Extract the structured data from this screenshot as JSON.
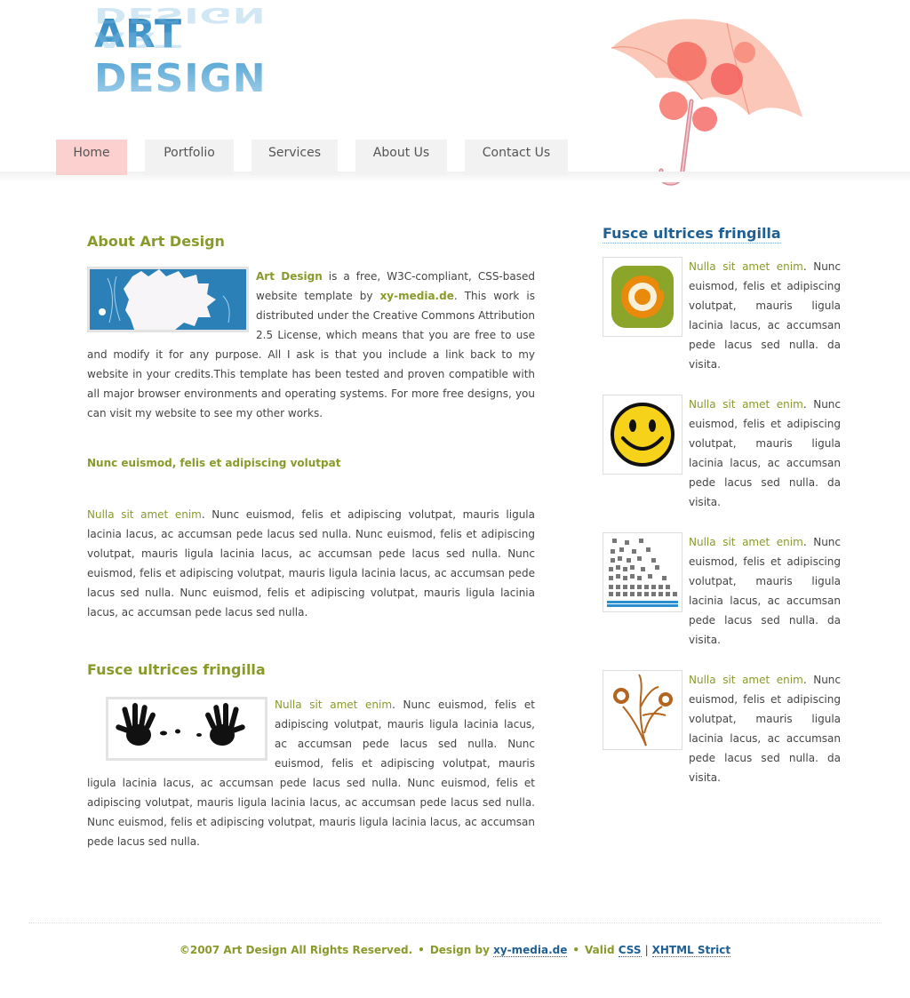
{
  "header": {
    "logo_text": "ART DESIGN"
  },
  "nav": {
    "items": [
      {
        "label": "Home",
        "active": true
      },
      {
        "label": "Portfolio",
        "active": false
      },
      {
        "label": "Services",
        "active": false
      },
      {
        "label": "About Us",
        "active": false
      },
      {
        "label": "Contact Us",
        "active": false
      }
    ]
  },
  "main": {
    "about": {
      "title": "About Art Design",
      "brand": "Art Design",
      "text_1": " is a free, W3C-compliant, CSS-based website template by ",
      "link": "xy-media.de",
      "text_2": ". This work is distributed under the Creative Commons Attribution 2.5 License, which means that you are free to use and modify it for any purpose. All I ask is that you include a link back to my website in your credits.This template has been tested and proven compatible with all major browser environments and operating systems. For more free designs, you can visit my website to see my other works."
    },
    "sub_heading": "Nunc euismod, felis et adipiscing volutpat",
    "nulla": {
      "lead": "Nulla sit amet enim",
      "text": ". Nunc euismod, felis et adipiscing volutpat, mauris ligula lacinia lacus, ac accumsan pede lacus sed nulla. Nunc euismod, felis et adipiscing volutpat, mauris ligula lacinia lacus, ac accumsan pede lacus sed nulla. Nunc euismod, felis et adipiscing volutpat, mauris ligula lacinia lacus, ac accumsan pede lacus sed nulla. Nunc euismod, felis et adipiscing volutpat, mauris ligula lacinia lacus, ac accumsan pede lacus sed nulla."
    },
    "fusce": {
      "title": "Fusce ultrices fringilla",
      "lead": "Nulla sit amet enim",
      "text": ". Nunc euismod, felis et adipiscing volutpat, mauris ligula lacinia lacus, ac accumsan pede lacus sed nulla. Nunc euismod, felis et adipiscing volutpat, mauris ligula lacinia lacus, ac accumsan pede lacus sed nulla. Nunc euismod, felis et adipiscing volutpat, mauris ligula lacinia lacus, ac accumsan pede lacus sed nulla. Nunc euismod, felis et adipiscing volutpat, mauris ligula lacinia lacus, ac accumsan pede lacus sed nulla."
    }
  },
  "sidebar": {
    "title": "Fusce ultrices fringilla",
    "items": [
      {
        "icon": "ring-logo-icon",
        "lead": "Nulla sit amet enim",
        "text": ". Nunc euismod, felis et adipiscing volutpat, mauris ligula lacinia lacus, ac accumsan pede lacus sed nulla. da visita."
      },
      {
        "icon": "smiley-icon",
        "lead": "Nulla sit amet enim",
        "text": ". Nunc euismod, felis et adipiscing volutpat, mauris ligula lacinia lacus, ac accumsan pede lacus sed nulla. da visita."
      },
      {
        "icon": "pixel-grid-icon",
        "lead": "Nulla sit amet enim",
        "text": ". Nunc euismod, felis et adipiscing volutpat, mauris ligula lacinia lacus, ac accumsan pede lacus sed nulla. da visita."
      },
      {
        "icon": "floral-swirl-icon",
        "lead": "Nulla sit amet enim",
        "text": ". Nunc euismod, felis et adipiscing volutpat, mauris ligula lacinia lacus, ac accumsan pede lacus sed nulla. da visita."
      }
    ]
  },
  "footer": {
    "copyright": "©2007 Art Design All Rights Reserved.",
    "design_by_label": "Design by",
    "design_by_link": "xy-media.de",
    "valid_label": "Valid",
    "css_link": "CSS",
    "separator": "|",
    "xhtml_link": "XHTML Strict",
    "bullet": "•"
  },
  "colors": {
    "accent_green": "#8a9a2a",
    "accent_blue": "#1f5f91",
    "nav_active_bg": "#fdd0d0",
    "nav_bg": "#f2f2f2"
  }
}
